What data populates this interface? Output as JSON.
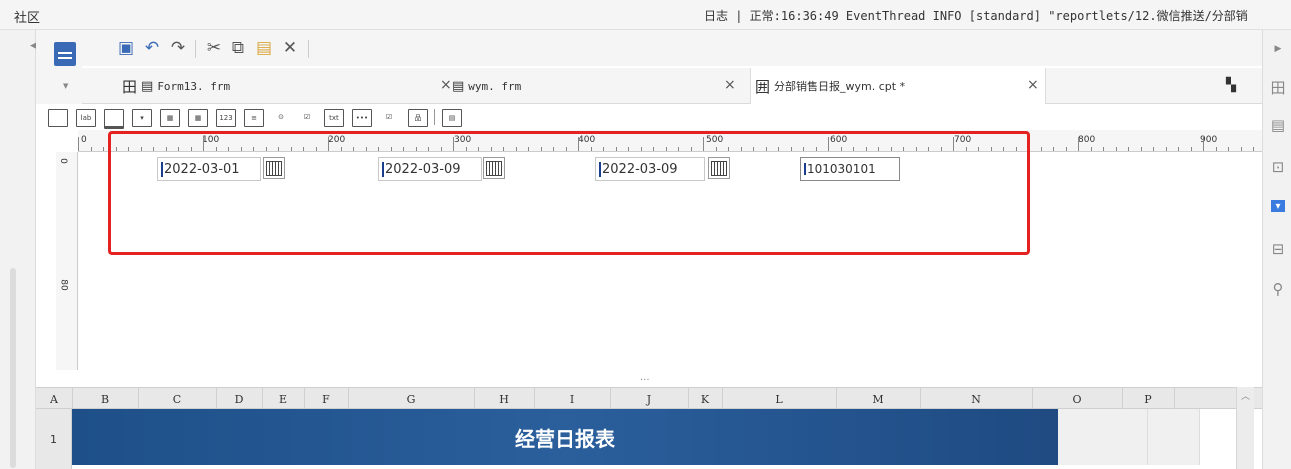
{
  "topbar": {
    "community": "社区",
    "log_text": "日志 | 正常:16:36:49 EventThread INFO [standard] \"reportlets/12.微信推送/分部销"
  },
  "tabs": [
    {
      "label": "Form13. frm",
      "icon": "form-icon"
    },
    {
      "label": "wym. frm",
      "icon": "form-icon"
    },
    {
      "label": "分部销售日报_wym. cpt *",
      "icon": "report-icon"
    }
  ],
  "ruler": {
    "labels": [
      "0",
      "100",
      "200",
      "300",
      "400",
      "500",
      "600",
      "700",
      "800",
      "900"
    ],
    "vlabels": [
      "0",
      "80"
    ]
  },
  "widget_icons": [
    "lab",
    "123",
    "txt"
  ],
  "fields": [
    {
      "value": "2022-03-01"
    },
    {
      "value": "2022-03-09"
    },
    {
      "value": "2022-03-09"
    },
    {
      "value": "101030101"
    }
  ],
  "grid": {
    "columns": [
      "A",
      "B",
      "C",
      "D",
      "E",
      "F",
      "G",
      "H",
      "I",
      "J",
      "K",
      "L",
      "M",
      "N",
      "O",
      "P"
    ],
    "row1_label": "1",
    "banner_title": "经营日报表",
    "scroll_dots": "..."
  },
  "colors": {
    "highlight_box": "#e52222",
    "banner": "#1e4f88",
    "accent": "#3a6ab5"
  }
}
